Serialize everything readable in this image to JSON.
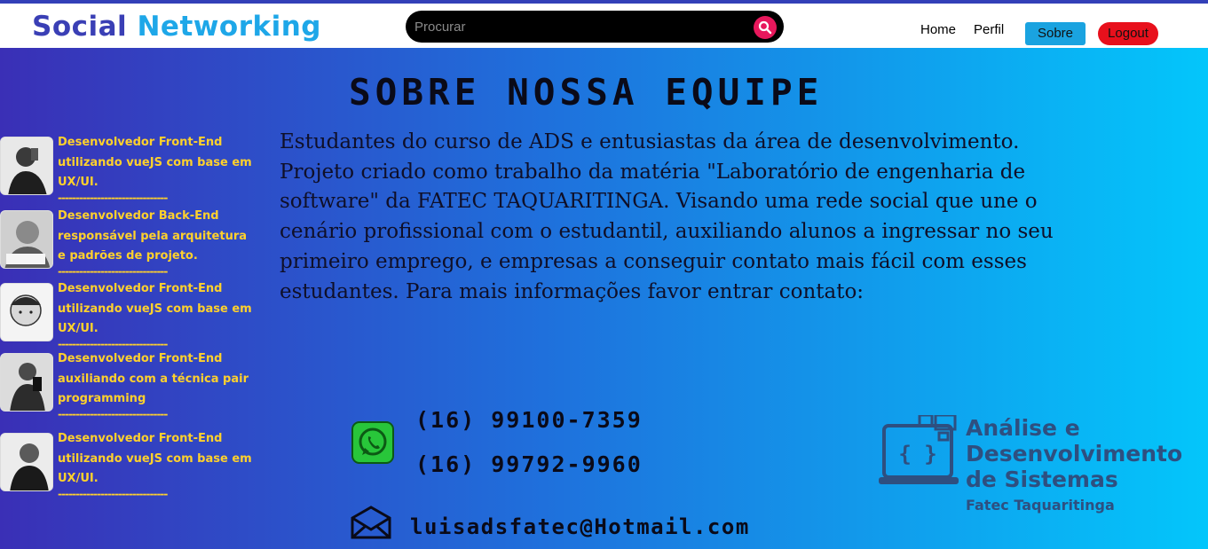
{
  "header": {
    "brand_part1": "Social",
    "brand_part2": "Networking",
    "search_placeholder": "Procurar",
    "nav": {
      "home": "Home",
      "perfil": "Perfil",
      "sobre": "Sobre",
      "logout": "Logout"
    }
  },
  "main": {
    "title": "SOBRE NOSSA EQUIPE",
    "about": "Estudantes do curso de ADS e entusiastas da área de desenvolvimento. Projeto criado como trabalho da matéria \"Laboratório de engenharia de software\" da FATEC TAQUARITINGA. Visando uma rede social que une o cenário profissional com o estudantil, auxiliando alunos a ingressar no seu primeiro emprego, e empresas a conseguir contato mais fácil com esses estudantes. Para mais informações favor entrar contato:",
    "phones": [
      "(16) 99100-7359",
      "(16) 99792-9960"
    ],
    "email": "luisadsfatec@Hotmail.com"
  },
  "members": [
    {
      "desc": "Desenvolvedor Front-End utilizando vueJS com base em UX/UI."
    },
    {
      "desc": "Desenvolvedor Back-End responsável pela arquitetura e padrões de projeto."
    },
    {
      "desc": "Desenvolvedor Front-End utilizando vueJS com base em UX/UI."
    },
    {
      "desc": "Desenvolvedor Front-End auxiliando com a técnica pair programming"
    },
    {
      "desc": "Desenvolvedor Front-End utilizando vueJS com base em UX/UI."
    }
  ],
  "separator": "-------------------------------",
  "ads_logo": {
    "line1": "Análise e",
    "line2": "Desenvolvimento",
    "line3": "de Sistemas",
    "line4": "Fatec Taquaritinga"
  },
  "colors": {
    "brand_dark": "#3a3fb5",
    "brand_light": "#1ea7e8",
    "accent_yellow": "#ffd12c",
    "sobre_button": "#1aa3e0",
    "logout_button": "#e8101c",
    "search_button": "#e8185c"
  }
}
